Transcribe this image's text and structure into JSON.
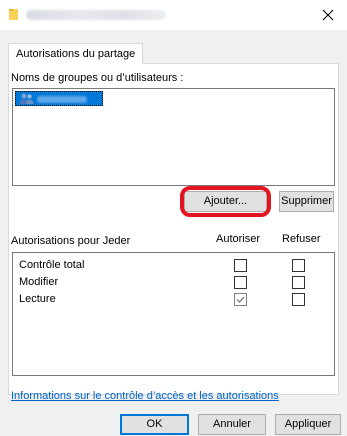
{
  "window": {
    "title": "",
    "close_icon": "close-icon"
  },
  "tab": {
    "label": "Autorisations du partage"
  },
  "groups": {
    "label": "Noms de groupes ou d’utilisateurs :",
    "selected_item_text": "",
    "item_icon": "user-group-icon"
  },
  "buttons": {
    "add": "Ajouter...",
    "remove": "Supprimer",
    "ok": "OK",
    "cancel": "Annuler",
    "apply": "Appliquer"
  },
  "permissions": {
    "label": "Autorisations pour Jeder",
    "col_allow": "Autoriser",
    "col_deny": "Refuser",
    "rows": [
      {
        "name": "Contrôle total",
        "allow": false,
        "deny": false,
        "allow_disabled": false
      },
      {
        "name": "Modifier",
        "allow": false,
        "deny": false,
        "allow_disabled": false
      },
      {
        "name": "Lecture",
        "allow": true,
        "deny": false,
        "allow_disabled": true
      }
    ]
  },
  "link": {
    "label": "Informations sur le contrôle d’accès et les autorisations"
  },
  "colors": {
    "selection": "#0078d7",
    "highlight_ring": "#e3141f",
    "link": "#0066cc",
    "folder": "#f8d05a"
  }
}
